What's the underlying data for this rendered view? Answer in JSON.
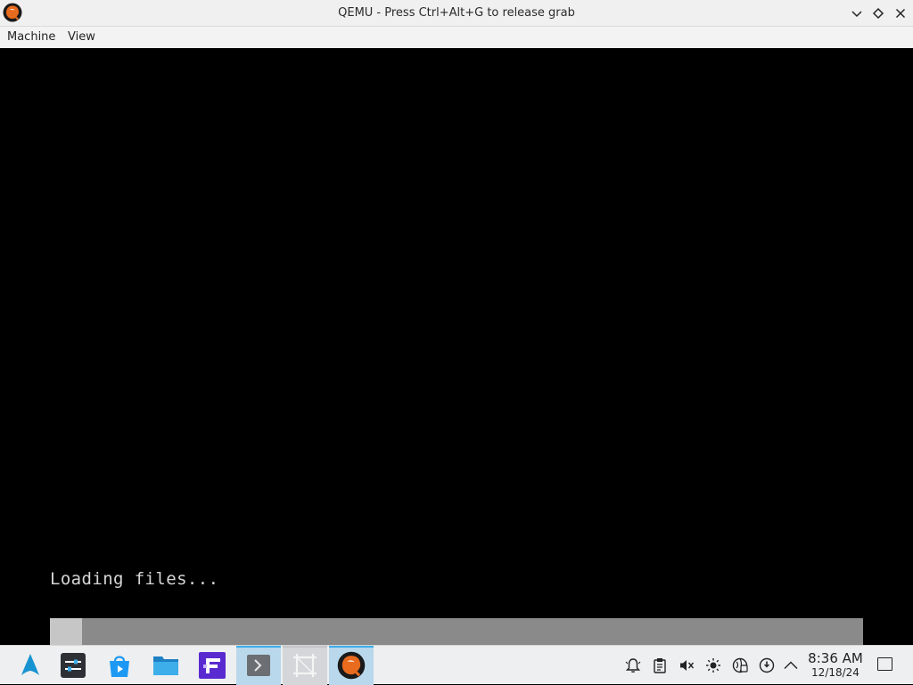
{
  "window": {
    "title": "QEMU - Press Ctrl+Alt+G to release grab",
    "icon": "qemu-icon",
    "controls": [
      "minimize-icon",
      "maximize-icon",
      "close-icon"
    ]
  },
  "menubar": {
    "items": [
      {
        "label": "Machine"
      },
      {
        "label": "View"
      }
    ]
  },
  "guest": {
    "loading_text": "Loading files...",
    "progress_fraction": 0.04
  },
  "taskbar": {
    "launcher_icon": "arch-linux-icon",
    "tasks": [
      {
        "icon": "system-settings-icon",
        "state": "normal"
      },
      {
        "icon": "discover-store-icon",
        "state": "normal"
      },
      {
        "icon": "file-manager-icon",
        "state": "normal"
      },
      {
        "icon": "fontforge-icon",
        "state": "normal"
      },
      {
        "icon": "terminal-icon",
        "state": "active"
      },
      {
        "icon": "screenshot-icon",
        "state": "hover"
      },
      {
        "icon": "qemu-icon",
        "state": "active"
      }
    ],
    "tray_icons": [
      "notifications-icon",
      "clipboard-icon",
      "volume-muted-icon",
      "brightness-icon",
      "network-icon",
      "update-icon",
      "expand-tray-icon"
    ],
    "clock": {
      "time": "8:36 AM",
      "date": "12/18/24"
    },
    "show_desktop_icon": "show-desktop-icon"
  },
  "colors": {
    "accent": "#3daee9",
    "guest_bg": "#000000",
    "progress_track": "#8a8a8a",
    "progress_fill": "#c6c6c6"
  }
}
